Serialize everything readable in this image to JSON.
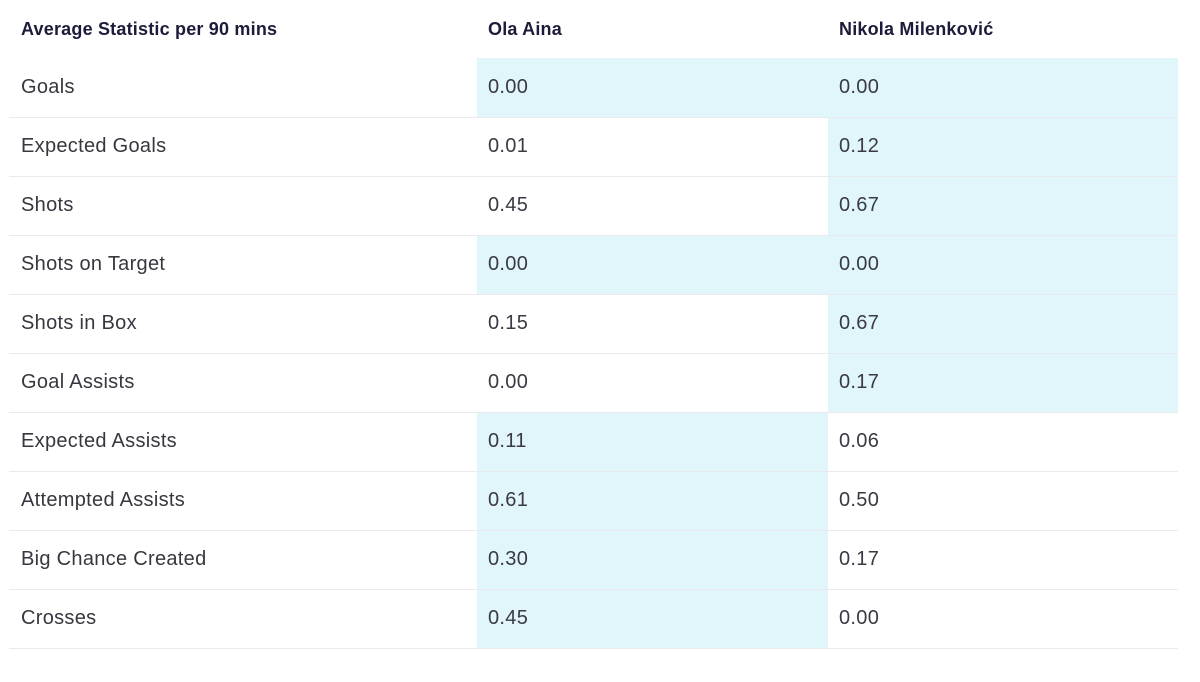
{
  "header": {
    "stat_label": "Average Statistic per 90 mins",
    "player1": "Ola Aina",
    "player2": "Nikola Milenković"
  },
  "highlight_color": "#e0f6fa",
  "rows": [
    {
      "stat": "Goals",
      "p1": "0.00",
      "p2": "0.00",
      "p1_highlight": true,
      "p2_highlight": true
    },
    {
      "stat": "Expected Goals",
      "p1": "0.01",
      "p2": "0.12",
      "p1_highlight": false,
      "p2_highlight": true
    },
    {
      "stat": "Shots",
      "p1": "0.45",
      "p2": "0.67",
      "p1_highlight": false,
      "p2_highlight": true
    },
    {
      "stat": "Shots on Target",
      "p1": "0.00",
      "p2": "0.00",
      "p1_highlight": true,
      "p2_highlight": true
    },
    {
      "stat": "Shots in Box",
      "p1": "0.15",
      "p2": "0.67",
      "p1_highlight": false,
      "p2_highlight": true
    },
    {
      "stat": "Goal Assists",
      "p1": "0.00",
      "p2": "0.17",
      "p1_highlight": false,
      "p2_highlight": true
    },
    {
      "stat": "Expected Assists",
      "p1": "0.11",
      "p2": "0.06",
      "p1_highlight": true,
      "p2_highlight": false
    },
    {
      "stat": "Attempted Assists",
      "p1": "0.61",
      "p2": "0.50",
      "p1_highlight": true,
      "p2_highlight": false
    },
    {
      "stat": "Big Chance Created",
      "p1": "0.30",
      "p2": "0.17",
      "p1_highlight": true,
      "p2_highlight": false
    },
    {
      "stat": "Crosses",
      "p1": "0.45",
      "p2": "0.00",
      "p1_highlight": true,
      "p2_highlight": false
    }
  ]
}
